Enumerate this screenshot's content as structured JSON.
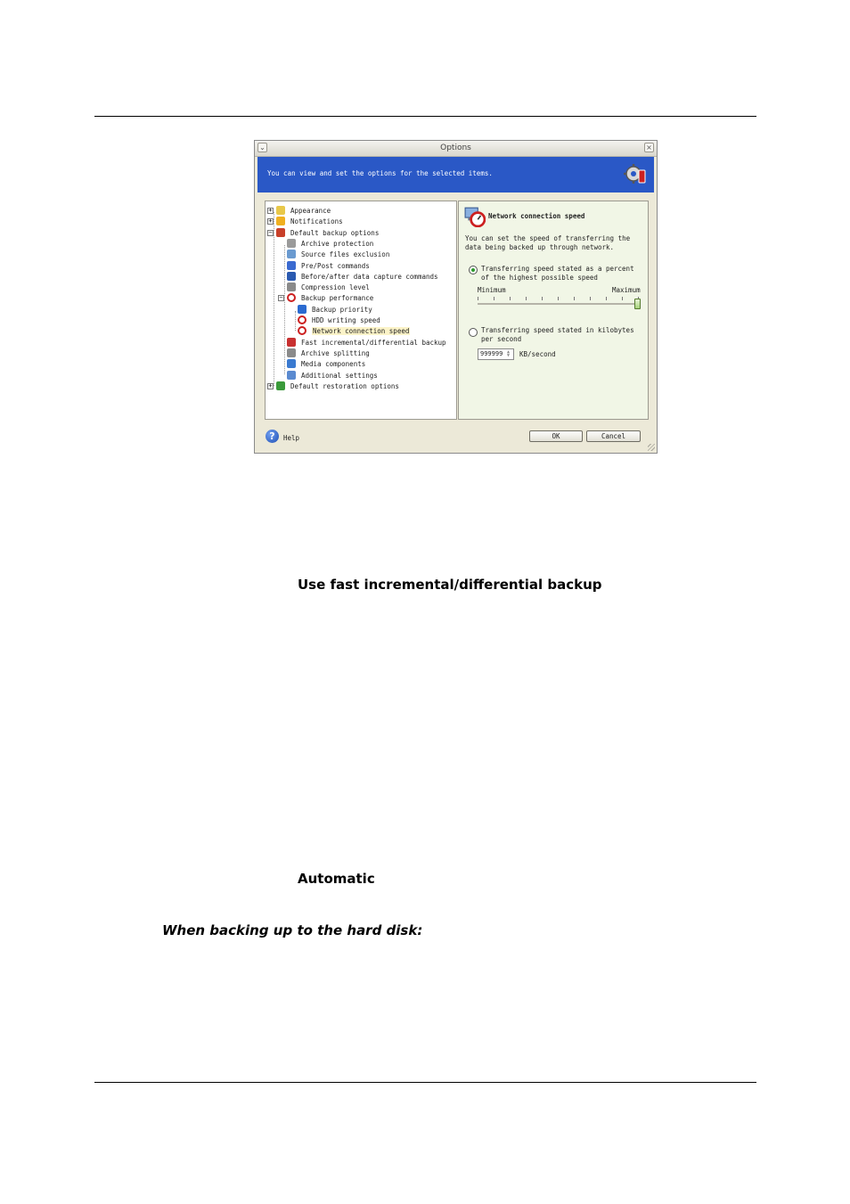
{
  "dialog": {
    "title": "Options",
    "banner_text": "You can view and set the options for the selected items.",
    "tree": [
      {
        "label": "Appearance",
        "icon": "appearance-icon",
        "color": "#e8c84a"
      },
      {
        "label": "Notifications",
        "icon": "notifications-icon",
        "color": "#f0b020"
      },
      {
        "label": "Default backup options",
        "icon": "backup-options-icon",
        "color": "#c8402a"
      },
      {
        "label": "Archive protection",
        "icon": "lock-icon",
        "color": "#9a9a9a"
      },
      {
        "label": "Source files exclusion",
        "icon": "filter-icon",
        "color": "#6a9ad0"
      },
      {
        "label": "Pre/Post commands",
        "icon": "window-icon",
        "color": "#3a6ad0"
      },
      {
        "label": "Before/after data capture commands",
        "icon": "console-icon",
        "color": "#2a5ab0"
      },
      {
        "label": "Compression level",
        "icon": "compression-icon",
        "color": "#8a8a8a"
      },
      {
        "label": "Backup performance",
        "icon": "performance-icon",
        "color": "#cc2020"
      },
      {
        "label": "Backup priority",
        "icon": "priority-icon",
        "color": "#2a6ad0"
      },
      {
        "label": "HDD writing speed",
        "icon": "speed-icon",
        "color": "#cc2020"
      },
      {
        "label": "Network connection speed",
        "icon": "network-speed-icon",
        "color": "#cc2020"
      },
      {
        "label": "Fast incremental/differential backup",
        "icon": "fast-backup-icon",
        "color": "#c83030"
      },
      {
        "label": "Archive splitting",
        "icon": "splitting-icon",
        "color": "#8a8a8a"
      },
      {
        "label": "Media components",
        "icon": "media-icon",
        "color": "#3a7ad0"
      },
      {
        "label": "Additional settings",
        "icon": "settings-icon",
        "color": "#5a8ad0"
      },
      {
        "label": "Default restoration options",
        "icon": "restore-options-icon",
        "color": "#3a9a3a"
      }
    ],
    "settings": {
      "title": "Network connection speed",
      "description": "You can set the speed of transferring the data being backed up through network.",
      "option_percent": "Transferring speed stated as a percent of the highest possible speed",
      "slider_min": "Minimum",
      "slider_max": "Maximum",
      "slider_level_percent": 100,
      "option_kbps": "Transferring speed stated in kilobytes per second",
      "speed_value": "999999",
      "speed_unit": "KB/second"
    },
    "help_label": "Help",
    "ok_label": "OK",
    "cancel_label": "Cancel"
  },
  "document": {
    "heading_fast_backup": "Use fast incremental/differential backup",
    "heading_automatic": "Automatic",
    "subheading_hard_disk": "When backing up to the hard disk:"
  }
}
